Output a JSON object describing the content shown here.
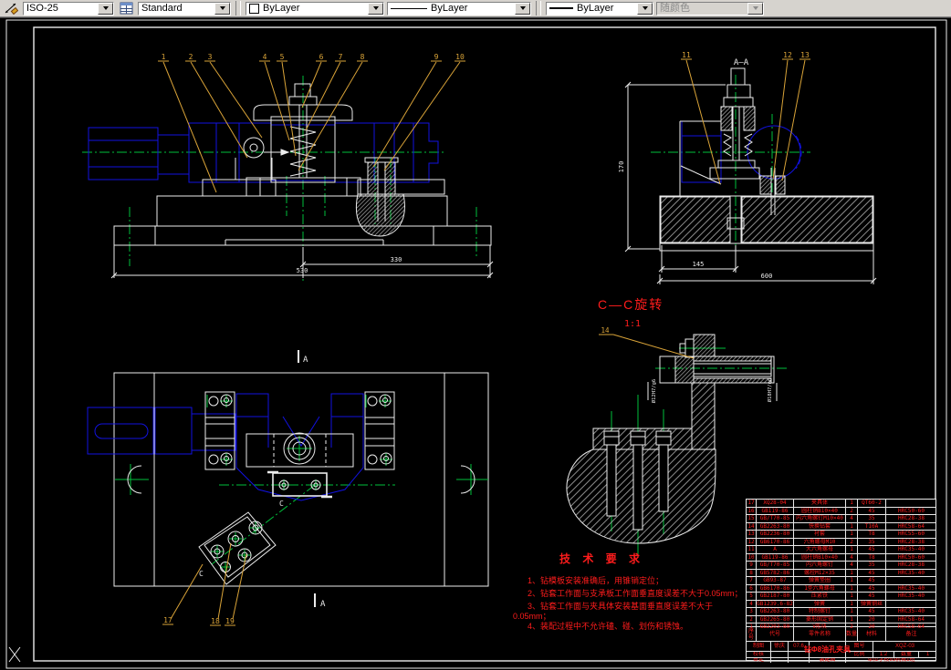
{
  "toolbar": {
    "dim_style": "ISO-25",
    "text_style": "Standard",
    "color": "ByLayer",
    "linetype": "ByLayer",
    "lineweight": "ByLayer",
    "plot_style": "随颜色"
  },
  "colors": {
    "line": "#ececec",
    "centerline": "#00c03c",
    "detail_blue": "#1212df",
    "leader_orange": "#d9a338",
    "annotation_red": "#ff1c1c",
    "toolbar_bg": "#d6d3ce"
  },
  "views": {
    "front": {
      "balloons": [
        "1",
        "2",
        "3",
        "4",
        "5",
        "6",
        "7",
        "8",
        "9",
        "10"
      ],
      "dim_top": "330",
      "dim_total": "530"
    },
    "aa": {
      "title": "A—A",
      "balloons": [
        "11",
        "12",
        "13"
      ],
      "dim_height": "170",
      "dim_left": "145",
      "dim_total": "600"
    },
    "plan": {
      "mark_top": "A",
      "mark_bottom": "A",
      "mark_c1": "C",
      "mark_c2": "C",
      "balloons": [
        "17",
        "18",
        "19"
      ]
    },
    "cc": {
      "title": "C—C旋转",
      "scale": "1:1",
      "balloon": "14",
      "fit_left": "Ø12H7/g6",
      "fit_right": "Ø18H7/n6"
    }
  },
  "tech_req": {
    "title": "技 术 要 求",
    "lines": [
      "1、钻模板安装准确后，用锥销定位；",
      "2、钻套工作面与支承板工作面垂直度误差不大于0.05mm；",
      "3、钻套工作面与夹具体安装基面垂直度误差不大于",
      "0.05mm；",
      "4、装配过程中不允许磕、碰、划伤和锈蚀。"
    ]
  },
  "bom": {
    "headers": [
      "序号",
      "代号",
      "零件名称",
      "数量",
      "材料",
      "备注"
    ],
    "rows": [
      [
        "17",
        "XQ28-04",
        "夹具体",
        "1",
        "QT60-2",
        ""
      ],
      [
        "16",
        "GB119-86",
        "圆柱销B10×40",
        "2",
        "45",
        "HRC50-60"
      ],
      [
        "15",
        "GB/T70-85",
        "内六角螺钉M10×40",
        "4",
        "35",
        "HRC28-38"
      ],
      [
        "14",
        "GB2263-80",
        "快换钻套",
        "1",
        "T10A",
        "HRC58-64"
      ],
      [
        "13",
        "GB2236-80",
        "衬套",
        "1",
        "T8",
        "HRC55-60"
      ],
      [
        "12",
        "GB6170-86",
        "六角螺母M10",
        "2",
        "35",
        "HRC28-38"
      ],
      [
        "11",
        "A",
        "大六角螺母",
        "1",
        "45",
        "HRC35-40"
      ],
      [
        "10",
        "GB119-86",
        "圆柱销B10×40",
        "4",
        "T8",
        "HRC50-60"
      ],
      [
        "9",
        "GB/T70-85",
        "内六角螺钉",
        "4",
        "35",
        "HRC28-38"
      ],
      [
        "8",
        "GB5782-86",
        "螺栓M12×35",
        "1",
        "45",
        "HRC35-40"
      ],
      [
        "7",
        "GB93-87",
        "弹簧垫圈",
        "1",
        "45",
        ""
      ],
      [
        "6",
        "GB6170-86",
        "1型六角螺母",
        "1",
        "45",
        "HRC35-40"
      ],
      [
        "5",
        "GB2187-80",
        "压紧铁",
        "1",
        "45",
        "HRC35-40"
      ],
      [
        "4",
        "GB1239.6-82",
        "弹簧",
        "1",
        "弹簧钢丝",
        ""
      ],
      [
        "3",
        "GB2263-80",
        "特制螺钉",
        "1",
        "45",
        "HRC35-40"
      ],
      [
        "2",
        "GB2265-80",
        "菱形固定销",
        "1",
        "20",
        "HRC58-64"
      ],
      [
        "1",
        "GB2203-80",
        "V形块",
        "2",
        "20",
        "HRC58-64"
      ]
    ]
  },
  "title_block": {
    "drawn_label": "制图",
    "drawn_by": "徐庆",
    "date": "07.6",
    "checked_label": "校核",
    "approved_label": "审定",
    "drawing_title": "钻Φ8油孔夹具",
    "drawing_type": "装配图",
    "no_label": "图号",
    "drawing_no": "XQZ-03",
    "scale_label": "比例",
    "scale": "1:2",
    "qty_label": "数量",
    "qty": "1",
    "org": "单位学校93机械1班"
  }
}
